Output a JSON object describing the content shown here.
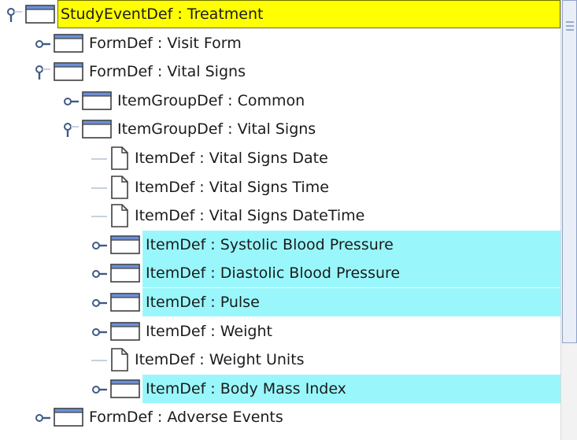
{
  "tree": {
    "nodes": [
      {
        "label": "StudyEventDef : Treatment",
        "depth": 0,
        "expander": "expanded",
        "icon": "folder-icon",
        "highlight": "selected"
      },
      {
        "label": "FormDef : Visit Form",
        "depth": 1,
        "expander": "collapsed",
        "icon": "folder-icon",
        "highlight": "none"
      },
      {
        "label": "FormDef : Vital Signs",
        "depth": 1,
        "expander": "expanded",
        "icon": "folder-icon",
        "highlight": "none"
      },
      {
        "label": "ItemGroupDef : Common",
        "depth": 2,
        "expander": "collapsed",
        "icon": "folder-icon",
        "highlight": "none"
      },
      {
        "label": "ItemGroupDef : Vital Signs",
        "depth": 2,
        "expander": "expanded",
        "icon": "folder-icon",
        "highlight": "none"
      },
      {
        "label": "ItemDef : Vital Signs Date",
        "depth": 3,
        "expander": "leaf",
        "icon": "document-icon",
        "highlight": "none"
      },
      {
        "label": "ItemDef : Vital Signs Time",
        "depth": 3,
        "expander": "leaf",
        "icon": "document-icon",
        "highlight": "none"
      },
      {
        "label": "ItemDef : Vital Signs DateTime",
        "depth": 3,
        "expander": "leaf",
        "icon": "document-icon",
        "highlight": "none"
      },
      {
        "label": "ItemDef : Systolic Blood Pressure",
        "depth": 3,
        "expander": "collapsed",
        "icon": "folder-icon",
        "highlight": "cyan"
      },
      {
        "label": "ItemDef : Diastolic Blood Pressure",
        "depth": 3,
        "expander": "collapsed",
        "icon": "folder-icon",
        "highlight": "cyan"
      },
      {
        "label": "ItemDef : Pulse",
        "depth": 3,
        "expander": "collapsed",
        "icon": "folder-icon",
        "highlight": "cyan"
      },
      {
        "label": "ItemDef : Weight",
        "depth": 3,
        "expander": "collapsed",
        "icon": "folder-icon",
        "highlight": "none"
      },
      {
        "label": "ItemDef : Weight Units",
        "depth": 3,
        "expander": "leaf",
        "icon": "document-icon",
        "highlight": "none"
      },
      {
        "label": "ItemDef : Body Mass Index",
        "depth": 3,
        "expander": "collapsed",
        "icon": "folder-icon",
        "highlight": "cyan"
      },
      {
        "label": "FormDef : Adverse Events",
        "depth": 1,
        "expander": "collapsed",
        "icon": "folder-icon",
        "highlight": "none"
      }
    ]
  },
  "colors": {
    "selected": "#ffff00",
    "cyan": "#99f7fb",
    "folder_tab": "#6b8fd6",
    "handle": "#3f5a86"
  }
}
